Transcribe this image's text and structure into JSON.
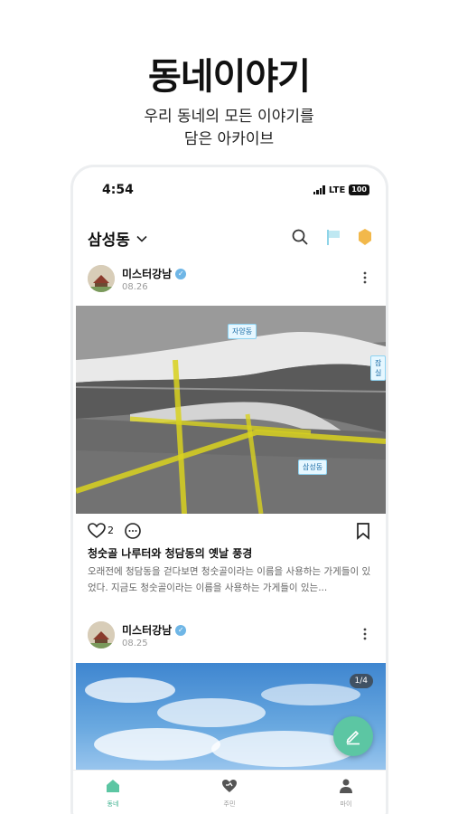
{
  "promo": {
    "title": "동네이야기",
    "subtitle_line1": "우리 동네의 모든 이야기를",
    "subtitle_line2": "담은 아카이브"
  },
  "status_bar": {
    "time": "4:54",
    "network": "LTE",
    "battery": "100"
  },
  "app_bar": {
    "location": "삼성동",
    "icons": [
      "search-icon",
      "flag-icon",
      "notification-icon"
    ],
    "accent_color": "#5cc6a3"
  },
  "posts": [
    {
      "author": "미스터강남",
      "date": "08.26",
      "likes": "2",
      "title": "청숫골 나루터와 청담동의 옛날 풍경",
      "body": "오래전에 청담동을 걷다보면 청숫골이라는 이름을 사용하는 가게들이 있었다. 지금도 청숫골이라는 이름을 사용하는 가게들이 있는...",
      "map_labels": [
        "자양동",
        "잠실",
        "삼성동"
      ]
    },
    {
      "author": "미스터강남",
      "date": "08.25",
      "page_indicator": "1/4"
    }
  ],
  "tabs": [
    {
      "label": "동네",
      "icon": "home-icon",
      "active": true
    },
    {
      "label": "주민",
      "icon": "heart-handshake-icon",
      "active": false
    },
    {
      "label": "마이",
      "icon": "person-icon",
      "active": false
    }
  ]
}
